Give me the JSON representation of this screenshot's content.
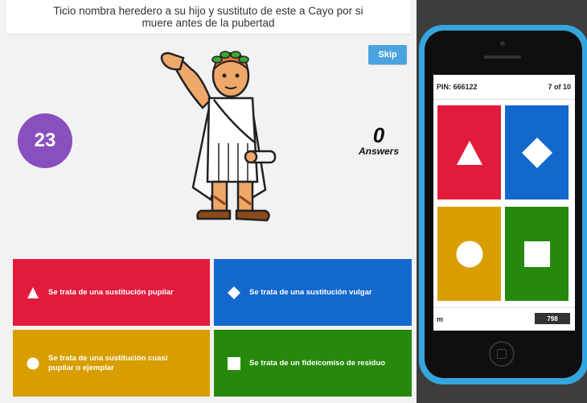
{
  "question": {
    "text": "Ticio nombra heredero a su hijo y sustituto de este a Cayo por si muere antes de la pubertad"
  },
  "host": {
    "skip_label": "Skip",
    "timer": "23",
    "answers_count": "0",
    "answers_label": "Answers",
    "image_icon": "roman-emperor-illustration"
  },
  "answers": [
    {
      "label": "Se trata de una sustitución pupilar",
      "shape": "triangle",
      "color": "#e21b3c"
    },
    {
      "label": "Se trata de una sustitución vulgar",
      "shape": "diamond",
      "color": "#1368ce"
    },
    {
      "label": "Se trata de una sustitución cuasi pupilar o ejemplar",
      "shape": "circle",
      "color": "#d89e00"
    },
    {
      "label": "Se trata de un fideicomiso de residuo",
      "shape": "square",
      "color": "#26890c"
    }
  ],
  "phone": {
    "pin": "PIN: 666122",
    "progress": "7 of 10",
    "nickname": "m",
    "score": "798",
    "frame_color": "#35a6dd"
  }
}
